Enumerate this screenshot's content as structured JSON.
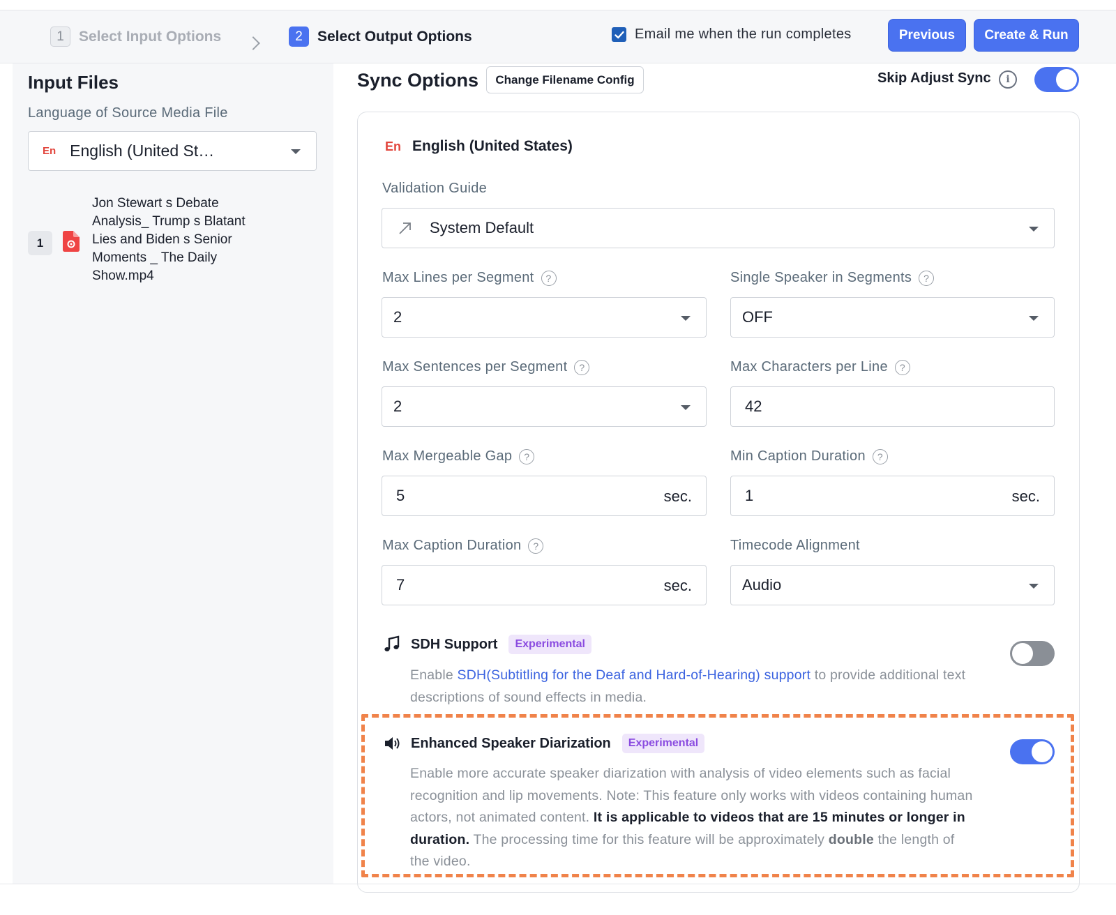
{
  "header": {
    "step1": {
      "num": "1",
      "label": "Select Input Options"
    },
    "step2": {
      "num": "2",
      "label": "Select Output Options"
    },
    "email_label": "Email me when the run completes",
    "email_checked": true,
    "previous_label": "Previous",
    "create_label": "Create & Run",
    "accent_color": "#4a72f0"
  },
  "left": {
    "title": "Input Files",
    "language_label": "Language of Source Media File",
    "language_badge": "En",
    "language_value": "English (United St…",
    "files": [
      {
        "num": "1",
        "name": "Jon Stewart s Debate Analysis_ Trump s Blatant Lies and Biden s Senior Moments _ The Daily Show.mp4",
        "icon": "video-file-icon"
      }
    ]
  },
  "sync": {
    "title": "Sync Options",
    "filename_config_label": "Change Filename Config",
    "skip_label": "Skip Adjust Sync",
    "skip_enabled": true
  },
  "card": {
    "lang_badge": "En",
    "lang_name": "English (United States)",
    "validation_label": "Validation Guide",
    "validation_value": "System Default",
    "max_lines_label": "Max Lines per Segment",
    "max_lines_value": "2",
    "single_speaker_label": "Single Speaker in Segments",
    "single_speaker_value": "OFF",
    "max_sentences_label": "Max Sentences per Segment",
    "max_sentences_value": "2",
    "max_chars_label": "Max Characters per Line",
    "max_chars_value": "42",
    "max_gap_label": "Max Mergeable Gap",
    "max_gap_value": "5",
    "min_caption_label": "Min Caption Duration",
    "min_caption_value": "1",
    "max_caption_label": "Max Caption Duration",
    "max_caption_value": "7",
    "unit": "sec.",
    "timecode_label": "Timecode Alignment",
    "timecode_value": "Audio"
  },
  "sdh": {
    "title": "SDH Support",
    "badge": "Experimental",
    "enabled": false,
    "desc_prefix": "Enable ",
    "desc_link": "SDH(Subtitling for the Deaf and Hard-of-Hearing) support",
    "desc_suffix": " to provide additional text descriptions of sound effects in media."
  },
  "diarization": {
    "title": "Enhanced Speaker Diarization",
    "badge": "Experimental",
    "enabled": true,
    "desc_part1": "Enable more accurate speaker diarization with analysis of video elements such as facial recognition and lip movements. Note: This feature only works with videos containing human actors, not animated content. ",
    "desc_bold": "It is applicable to videos that are 15 minutes or longer in duration.",
    "desc_part2": " The processing time for this feature will be approximately ",
    "desc_double": "double",
    "desc_part3": " the length of the video."
  },
  "highlight_color": "#f0834a"
}
